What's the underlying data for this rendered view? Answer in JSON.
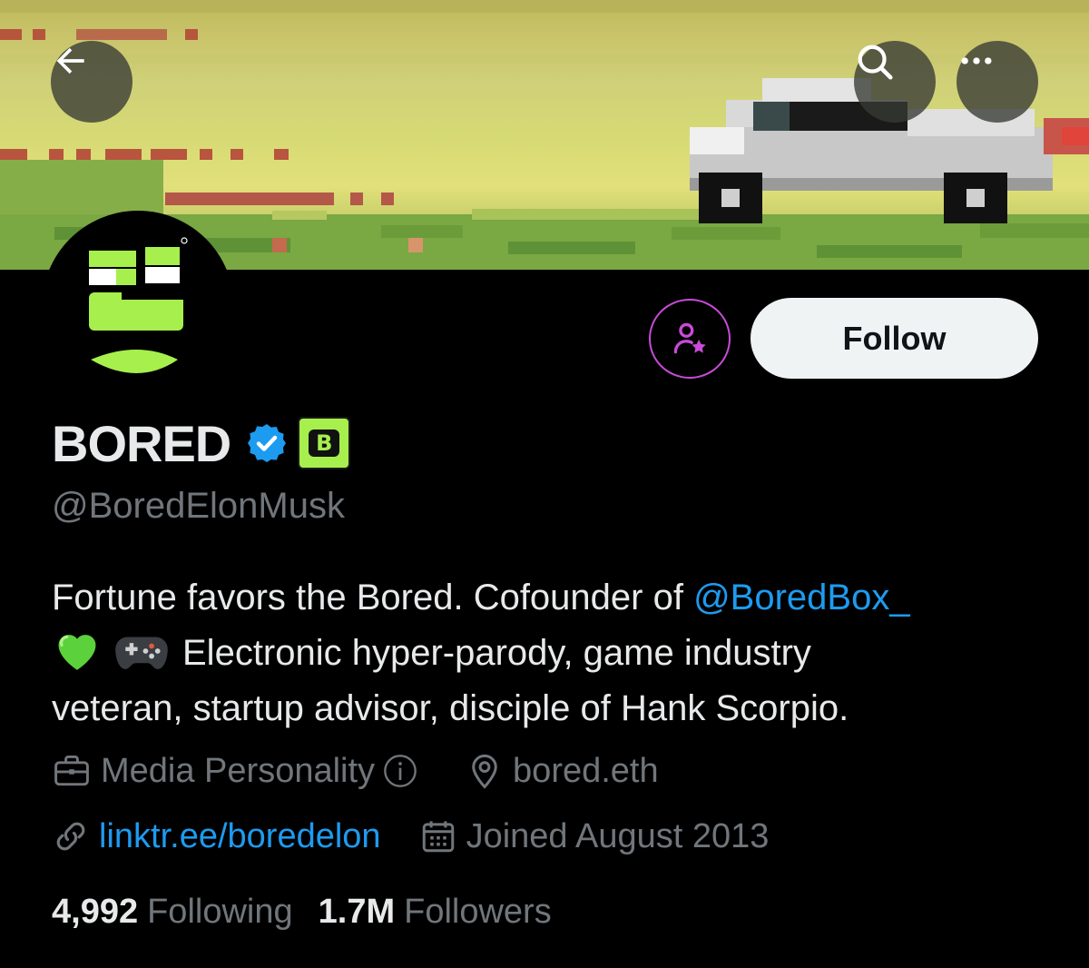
{
  "header": {
    "back_icon": "arrow-left-icon",
    "search_icon": "search-icon",
    "more_icon": "more-horizontal-icon"
  },
  "profile": {
    "display_name": "BORED",
    "handle": "@BoredElonMusk",
    "verified": true,
    "verified_color": "#1d9bf0",
    "affiliate_badge_letter": "B",
    "affiliate_badge_color": "#a6ef4d",
    "avatar_color": "#a6ef4d"
  },
  "actions": {
    "subscribe_icon": "person-star-icon",
    "subscribe_color": "#c94bd8",
    "follow_label": "Follow"
  },
  "bio": {
    "line1_text": "Fortune favors the Bored. Cofounder of ",
    "line1_mention": "@BoredBox_",
    "line2_emoji1": "💚",
    "line2_emoji2": "🎮",
    "line2_text": "Electronic hyper-parody, game industry",
    "line3_text": "veteran, startup advisor, disciple of Hank Scorpio."
  },
  "meta": {
    "category": "Media Personality",
    "category_icon": "briefcase-icon",
    "category_info_icon": "info-icon",
    "location": "bored.eth",
    "location_icon": "location-pin-icon",
    "website": "linktr.ee/boredelon",
    "website_icon": "link-icon",
    "joined": "Joined August 2013",
    "joined_icon": "calendar-icon"
  },
  "stats": {
    "following_count": "4,992",
    "following_label": "Following",
    "followers_count": "1.7M",
    "followers_label": "Followers"
  },
  "colors": {
    "background": "#000000",
    "text_primary": "#e7e9ea",
    "text_secondary": "#71767b",
    "link": "#1d9bf0"
  }
}
